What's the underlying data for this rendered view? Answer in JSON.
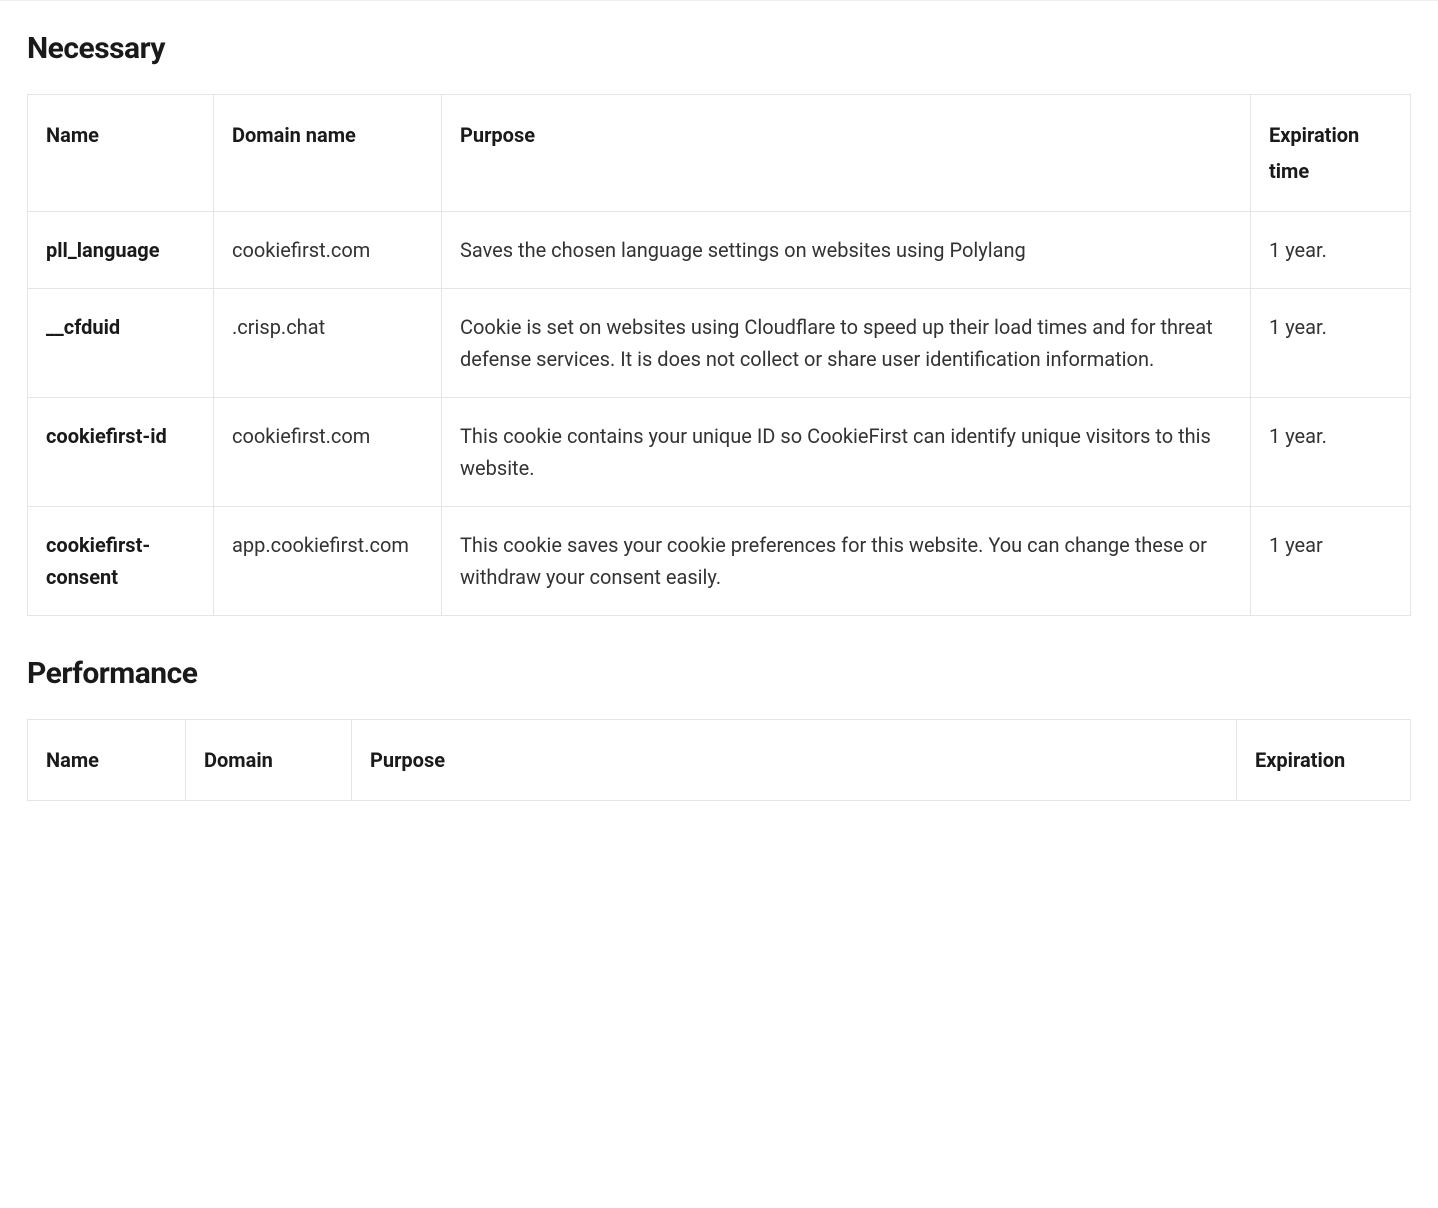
{
  "sections": {
    "necessary": {
      "heading": "Necessary",
      "columns": {
        "name": "Name",
        "domain": "Domain name",
        "purpose": "Purpose",
        "expiration": "Expiration time"
      },
      "rows": [
        {
          "name": "pll_language",
          "domain": "cookiefirst.com",
          "purpose": "Saves the chosen language settings on websites using Polylang",
          "expiration": "1 year."
        },
        {
          "name": "__cfduid",
          "domain": ".crisp.chat",
          "purpose": "Cookie is set on websites using Cloudflare to speed up their load times and for threat defense services. It is does not collect or share user identification information.",
          "expiration": "1 year."
        },
        {
          "name": "cookiefirst-id",
          "domain": "cookiefirst.com",
          "purpose": "This cookie contains your unique ID so CookieFirst can identify unique visitors to this website.",
          "expiration": "1 year."
        },
        {
          "name": "cookiefirst-consent",
          "domain": "app.cookiefirst.com",
          "purpose": "This cookie saves your cookie preferences for this website. You can change these or withdraw your consent easily.",
          "expiration": "1 year"
        }
      ]
    },
    "performance": {
      "heading": "Performance",
      "columns": {
        "name": "Name",
        "domain": "Domain",
        "purpose": "Purpose",
        "expiration": "Expiration"
      }
    }
  }
}
